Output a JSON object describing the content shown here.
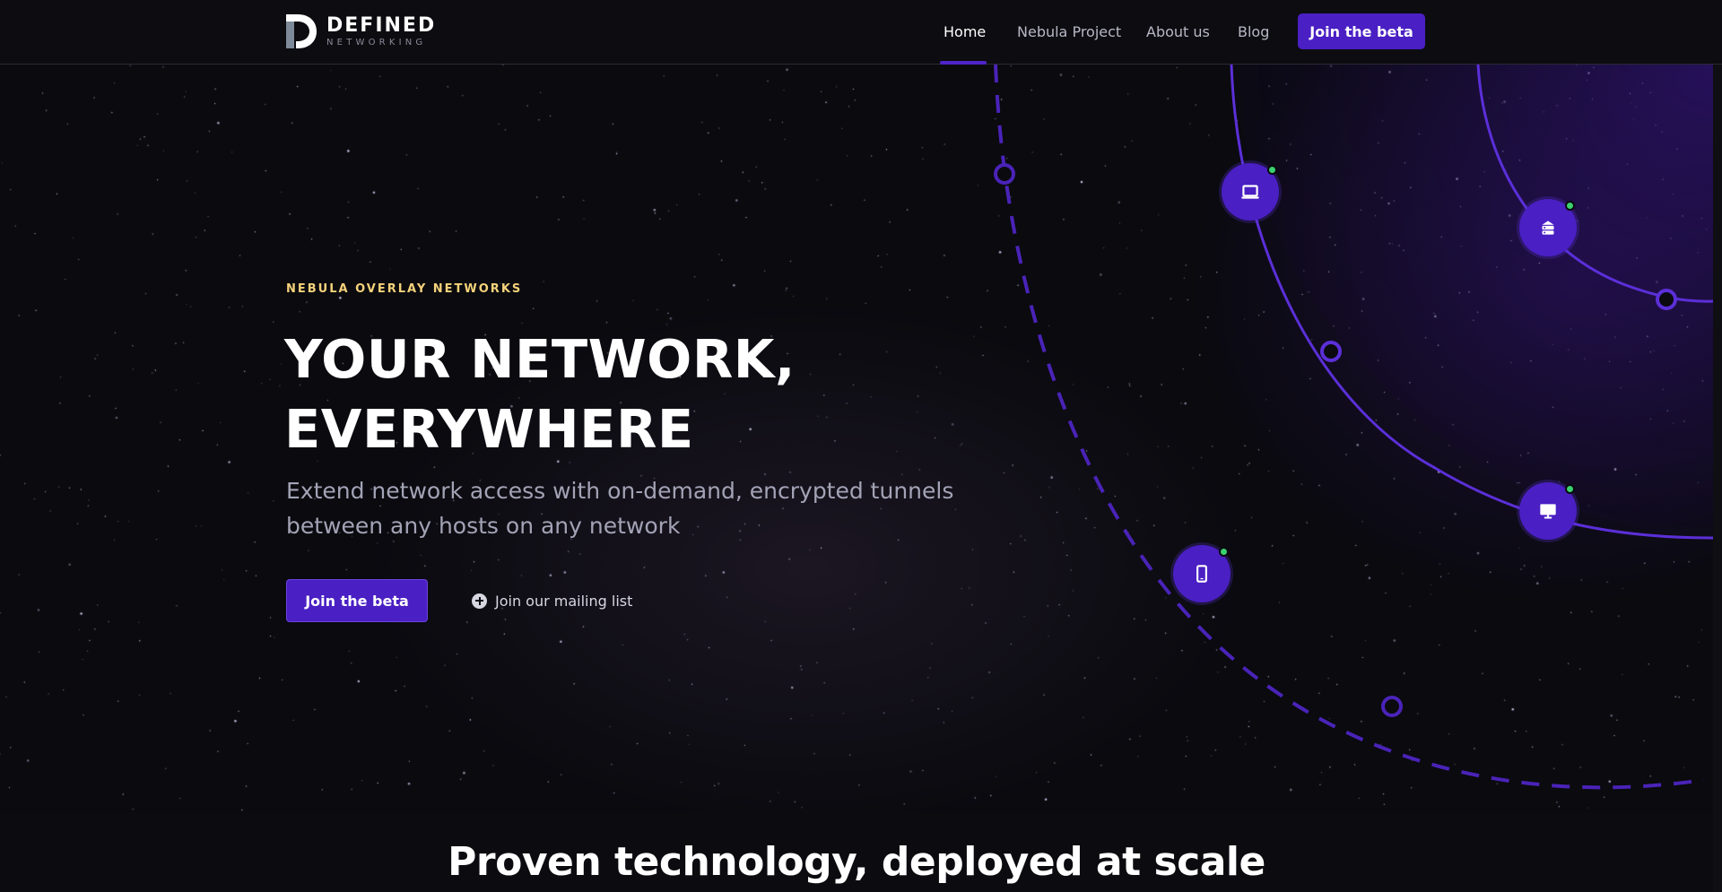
{
  "nav": {
    "logo_title": "DEFINED",
    "logo_sub": "NETWORKING",
    "links": [
      "Home",
      "Nebula Project",
      "About us",
      "Blog"
    ],
    "active": "Home",
    "cta": "Join the beta"
  },
  "hero": {
    "eyebrow": "NEBULA OVERLAY NETWORKS",
    "headline_line1": "YOUR NETWORK,",
    "headline_line2": "EVERYWHERE",
    "subhead": "Extend network access with on-demand, encrypted tunnels between any hosts on any network",
    "cta": "Join the beta",
    "mailing": "Join our mailing list"
  },
  "devices": [
    {
      "icon": "laptop-icon",
      "status": "online"
    },
    {
      "icon": "server-icon",
      "status": "online"
    },
    {
      "icon": "monitor-icon",
      "status": "online"
    },
    {
      "icon": "phone-icon",
      "status": "online"
    }
  ],
  "section": {
    "title": "Proven technology, deployed at scale"
  },
  "colors": {
    "accent": "#4a1fc3",
    "eyebrow": "#f5d27a",
    "status_online": "#3bd16f",
    "background": "#0a0a0f"
  }
}
